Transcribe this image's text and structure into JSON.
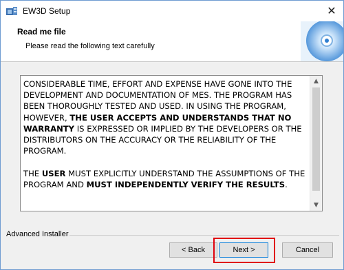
{
  "window": {
    "title": "EW3D Setup",
    "close_glyph": "✕"
  },
  "header": {
    "title": "Read me file",
    "subtitle": "Please read the following text carefully"
  },
  "readme": {
    "paragraph1_a": "CONSIDERABLE TIME, EFFORT AND EXPENSE HAVE GONE INTO THE DEVELOPMENT AND DOCUMENTATION OF MES. THE PROGRAM HAS BEEN THOROUGHLY TESTED AND USED. IN USING THE PROGRAM, HOWEVER, ",
    "paragraph1_b": "THE USER ACCEPTS AND UNDERSTANDS THAT NO WARRANTY",
    "paragraph1_c": " IS EXPRESSED OR IMPLIED BY THE DEVELOPERS OR THE DISTRIBUTORS ON THE ACCURACY OR THE RELIABILITY OF THE PROGRAM.",
    "paragraph2_a": "THE ",
    "paragraph2_b": "USER",
    "paragraph2_c": " MUST EXPLICITLY UNDERSTAND THE ASSUMPTIONS OF THE PROGRAM AND ",
    "paragraph2_d": "MUST INDEPENDENTLY VERIFY THE RESULTS",
    "paragraph2_e": "."
  },
  "footer": {
    "brand": "Advanced Installer",
    "back_label": "< Back",
    "next_label": "Next >",
    "cancel_label": "Cancel"
  },
  "colors": {
    "highlight": "#e0000b",
    "focus_border": "#0078d7",
    "window_border": "#6e9bd1"
  },
  "icons": {
    "app": "setup-box-icon",
    "header": "disc-graphic-icon",
    "scroll_up": "chevron-up-icon",
    "scroll_down": "chevron-down-icon"
  }
}
